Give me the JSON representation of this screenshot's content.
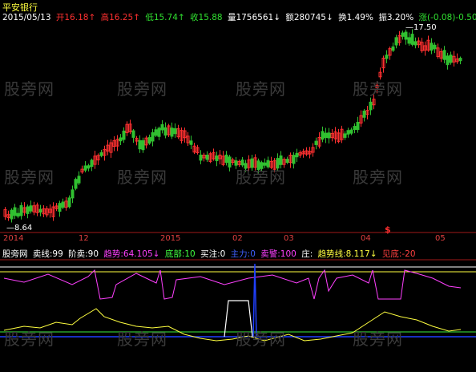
{
  "header": {
    "stock_name": "平安银行",
    "date": "2015/05/13",
    "open": {
      "label": "开",
      "value": "16.18",
      "arrow": "↑"
    },
    "high": {
      "label": "高",
      "value": "16.25",
      "arrow": "↑"
    },
    "low": {
      "label": "低",
      "value": "15.74",
      "arrow": "↑"
    },
    "close": {
      "label": "收",
      "value": "15.88",
      "arrow": ""
    },
    "volume": {
      "label": "量",
      "value": "1756561",
      "arrow": "↓"
    },
    "amount": {
      "label": "额",
      "value": "280745",
      "arrow": "↓"
    },
    "turnover": {
      "label": "换",
      "value": "1.49%"
    },
    "amplitude": {
      "label": "振",
      "value": "3.20%"
    },
    "change": {
      "label": "涨",
      "value": "(-0.08)",
      "pct": "-0.50"
    }
  },
  "price_labels": {
    "peak": "17.50",
    "trough": "8.64"
  },
  "marker": "$",
  "date_axis": [
    "2014",
    "12",
    "2015",
    "02",
    "03",
    "04",
    "05"
  ],
  "indicator": {
    "name": "股旁网",
    "items": [
      {
        "label": "卖线",
        "value": "99",
        "color": "#ffffff"
      },
      {
        "label": "阶卖",
        "value": "90",
        "color": "#ffffff"
      },
      {
        "label": "趋势",
        "value": "64.105",
        "color": "#ff40ff"
      },
      {
        "label": "底部",
        "value": "10",
        "color": "#40ff40"
      },
      {
        "label": "买注",
        "value": "0",
        "color": "#ffffff"
      },
      {
        "label": "主力",
        "value": "0",
        "color": "#4060ff"
      },
      {
        "label": "卖警",
        "value": "100",
        "color": "#ff40ff"
      },
      {
        "label": "庄",
        "value": "",
        "color": "#ffffff"
      },
      {
        "label": "趋势线",
        "value": "8.117",
        "color": "#ffff40"
      },
      {
        "label": "见底",
        "value": "-20",
        "color": "#ff4040"
      }
    ]
  },
  "watermark": "股旁网",
  "colors": {
    "up": "#ff3030",
    "down": "#20e0e0",
    "green": "#30c030",
    "magenta": "#ff40ff",
    "yellow": "#ffff40",
    "blue": "#2040ff",
    "grid": "#a01818"
  }
}
